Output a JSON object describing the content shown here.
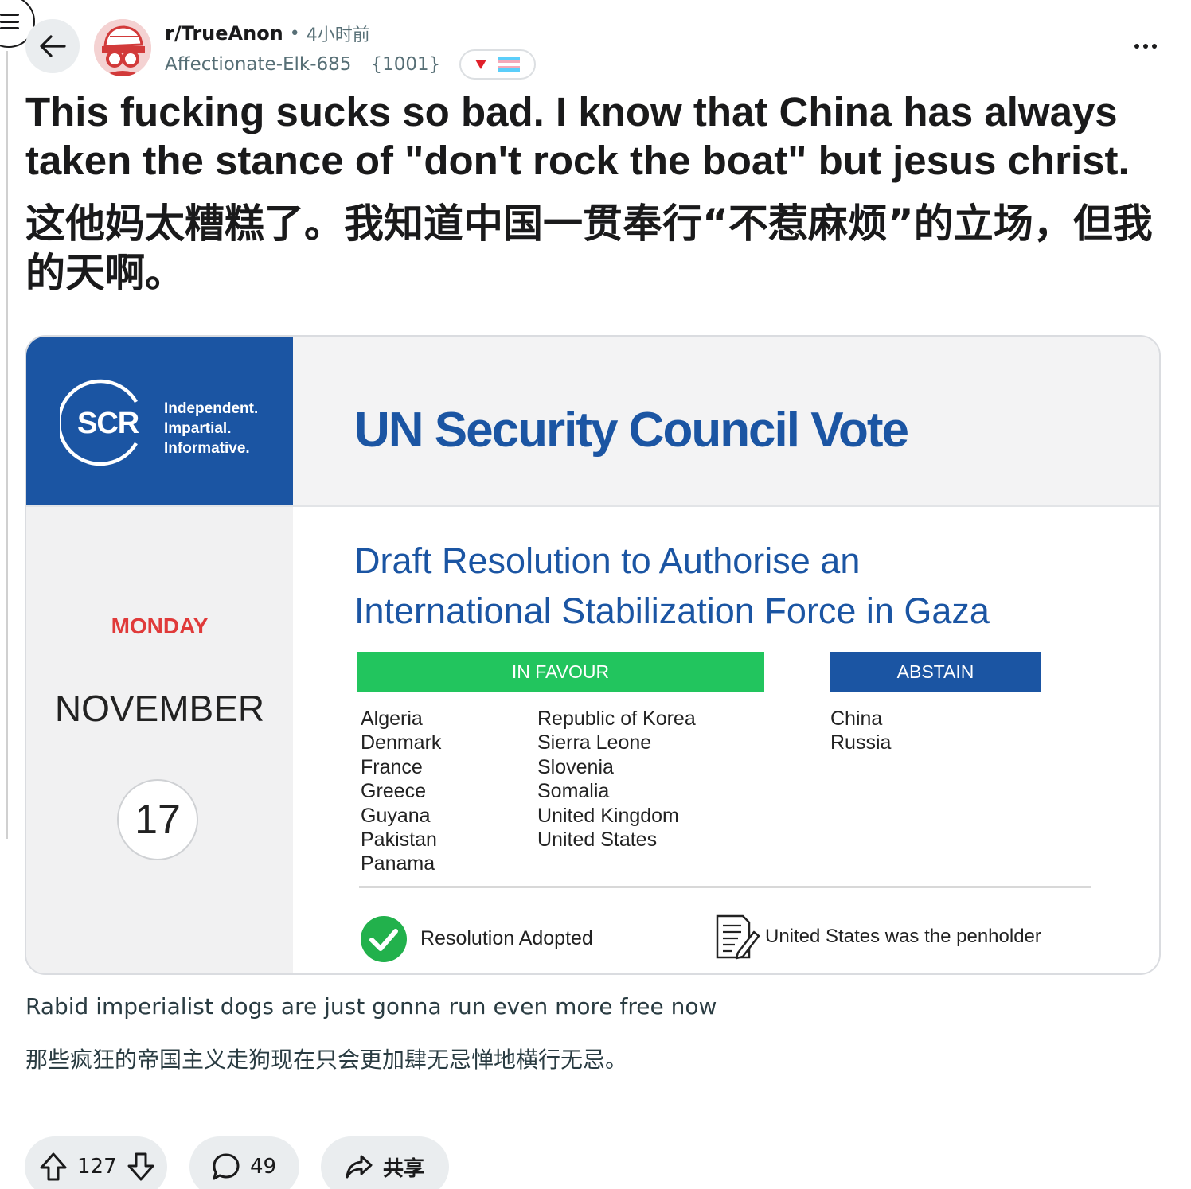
{
  "header": {
    "subreddit": "r/TrueAnon",
    "time_ago": "4小时前",
    "separator": "•",
    "username": "Affectionate-Elk-685",
    "user_flair": "{1001}"
  },
  "post": {
    "title_en": "This fucking sucks so bad. I know that China has always taken the stance of \"don't rock the boat\" but jesus christ.",
    "title_zh": "这他妈太糟糕了。我知道中国一贯奉行“不惹麻烦”的立场，但我的天啊。",
    "body_en": "Rabid imperialist dogs are just gonna run even more free now",
    "body_zh": "那些疯狂的帝国主义走狗现在只会更加肆无忌惮地横行无忌。"
  },
  "card": {
    "logo_text": "SCR",
    "tagline": [
      "Independent.",
      "Impartial.",
      "Informative."
    ],
    "heading": "UN Security Council Vote",
    "day": "MONDAY",
    "month": "NOVEMBER",
    "date": "17",
    "draft_line1": "Draft Resolution to Authorise an",
    "draft_line2": "International Stabilization Force in Gaza",
    "in_favour_label": "IN FAVOUR",
    "abstain_label": "ABSTAIN",
    "in_favour_col1": [
      "Algeria",
      "Denmark",
      "France",
      "Greece",
      "Guyana",
      "Pakistan",
      "Panama"
    ],
    "in_favour_col2": [
      "Republic of Korea",
      "Sierra Leone",
      "Slovenia",
      "Somalia",
      "United Kingdom",
      "United States"
    ],
    "abstain": [
      "China",
      "Russia"
    ],
    "result": "Resolution Adopted",
    "penholder": "United States was the penholder"
  },
  "actions": {
    "votes": "127",
    "comments": "49",
    "share": "共享"
  },
  "colors": {
    "brand_blue": "#1b55a3",
    "favour_green": "#22c55e",
    "day_red": "#e03a3a",
    "pill_bg": "#eaedef"
  },
  "icons": [
    "menu-icon",
    "back-arrow-icon",
    "more-icon",
    "downvote-flair-icon",
    "trans-flag-icon",
    "check-circle-icon",
    "document-pen-icon",
    "upvote-icon",
    "downvote-icon",
    "comment-icon",
    "share-icon"
  ]
}
